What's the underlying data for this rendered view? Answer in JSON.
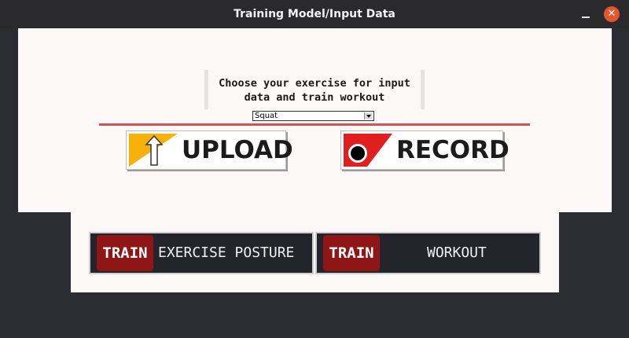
{
  "window": {
    "title": "Training Model/Input Data"
  },
  "prompt": {
    "text": "Choose your exercise for input\ndata and train workout"
  },
  "exercise_select": {
    "selected": "Squat"
  },
  "buttons": {
    "upload": "UPLOAD",
    "record": "RECORD",
    "train_posture_tag": "TRAIN",
    "train_posture_label": "EXERCISE POSTURE",
    "train_workout_tag": "TRAIN",
    "train_workout_label": "WORKOUT"
  },
  "colors": {
    "accent_red": "#cf5555",
    "train_red": "#8e1616",
    "upload_yellow": "#f6b10a",
    "record_red": "#e21f1f",
    "dark_button": "#23252b"
  }
}
